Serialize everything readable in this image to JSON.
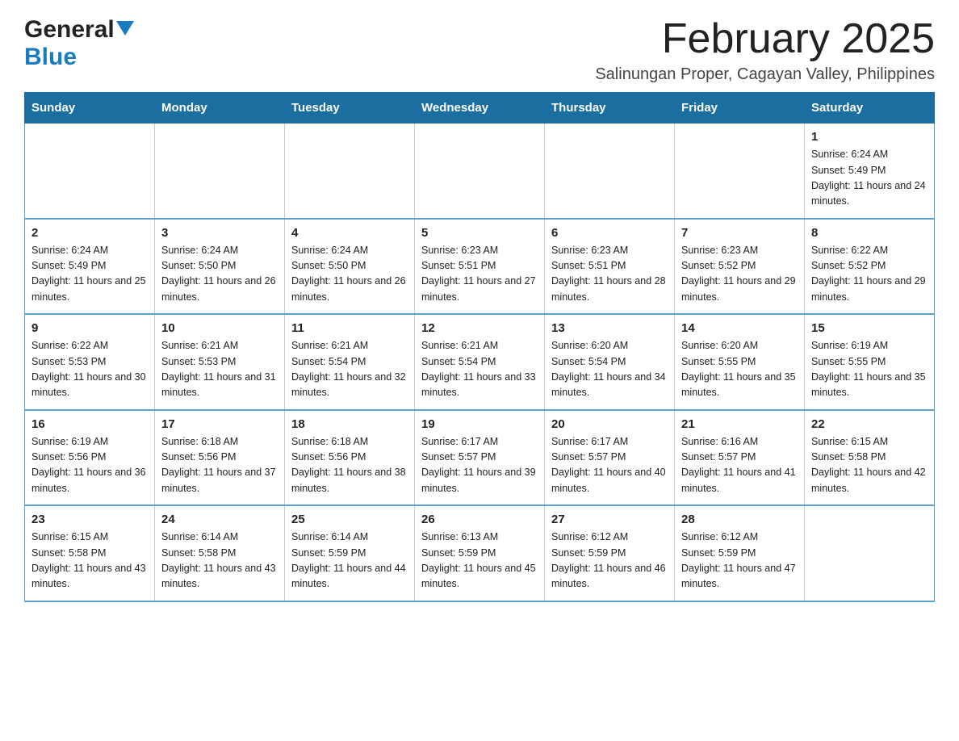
{
  "logo": {
    "general": "General",
    "blue": "Blue"
  },
  "title": {
    "month": "February 2025",
    "location": "Salinungan Proper, Cagayan Valley, Philippines"
  },
  "days_of_week": [
    "Sunday",
    "Monday",
    "Tuesday",
    "Wednesday",
    "Thursday",
    "Friday",
    "Saturday"
  ],
  "weeks": [
    [
      {
        "day": "",
        "info": ""
      },
      {
        "day": "",
        "info": ""
      },
      {
        "day": "",
        "info": ""
      },
      {
        "day": "",
        "info": ""
      },
      {
        "day": "",
        "info": ""
      },
      {
        "day": "",
        "info": ""
      },
      {
        "day": "1",
        "info": "Sunrise: 6:24 AM\nSunset: 5:49 PM\nDaylight: 11 hours and 24 minutes."
      }
    ],
    [
      {
        "day": "2",
        "info": "Sunrise: 6:24 AM\nSunset: 5:49 PM\nDaylight: 11 hours and 25 minutes."
      },
      {
        "day": "3",
        "info": "Sunrise: 6:24 AM\nSunset: 5:50 PM\nDaylight: 11 hours and 26 minutes."
      },
      {
        "day": "4",
        "info": "Sunrise: 6:24 AM\nSunset: 5:50 PM\nDaylight: 11 hours and 26 minutes."
      },
      {
        "day": "5",
        "info": "Sunrise: 6:23 AM\nSunset: 5:51 PM\nDaylight: 11 hours and 27 minutes."
      },
      {
        "day": "6",
        "info": "Sunrise: 6:23 AM\nSunset: 5:51 PM\nDaylight: 11 hours and 28 minutes."
      },
      {
        "day": "7",
        "info": "Sunrise: 6:23 AM\nSunset: 5:52 PM\nDaylight: 11 hours and 29 minutes."
      },
      {
        "day": "8",
        "info": "Sunrise: 6:22 AM\nSunset: 5:52 PM\nDaylight: 11 hours and 29 minutes."
      }
    ],
    [
      {
        "day": "9",
        "info": "Sunrise: 6:22 AM\nSunset: 5:53 PM\nDaylight: 11 hours and 30 minutes."
      },
      {
        "day": "10",
        "info": "Sunrise: 6:21 AM\nSunset: 5:53 PM\nDaylight: 11 hours and 31 minutes."
      },
      {
        "day": "11",
        "info": "Sunrise: 6:21 AM\nSunset: 5:54 PM\nDaylight: 11 hours and 32 minutes."
      },
      {
        "day": "12",
        "info": "Sunrise: 6:21 AM\nSunset: 5:54 PM\nDaylight: 11 hours and 33 minutes."
      },
      {
        "day": "13",
        "info": "Sunrise: 6:20 AM\nSunset: 5:54 PM\nDaylight: 11 hours and 34 minutes."
      },
      {
        "day": "14",
        "info": "Sunrise: 6:20 AM\nSunset: 5:55 PM\nDaylight: 11 hours and 35 minutes."
      },
      {
        "day": "15",
        "info": "Sunrise: 6:19 AM\nSunset: 5:55 PM\nDaylight: 11 hours and 35 minutes."
      }
    ],
    [
      {
        "day": "16",
        "info": "Sunrise: 6:19 AM\nSunset: 5:56 PM\nDaylight: 11 hours and 36 minutes."
      },
      {
        "day": "17",
        "info": "Sunrise: 6:18 AM\nSunset: 5:56 PM\nDaylight: 11 hours and 37 minutes."
      },
      {
        "day": "18",
        "info": "Sunrise: 6:18 AM\nSunset: 5:56 PM\nDaylight: 11 hours and 38 minutes."
      },
      {
        "day": "19",
        "info": "Sunrise: 6:17 AM\nSunset: 5:57 PM\nDaylight: 11 hours and 39 minutes."
      },
      {
        "day": "20",
        "info": "Sunrise: 6:17 AM\nSunset: 5:57 PM\nDaylight: 11 hours and 40 minutes."
      },
      {
        "day": "21",
        "info": "Sunrise: 6:16 AM\nSunset: 5:57 PM\nDaylight: 11 hours and 41 minutes."
      },
      {
        "day": "22",
        "info": "Sunrise: 6:15 AM\nSunset: 5:58 PM\nDaylight: 11 hours and 42 minutes."
      }
    ],
    [
      {
        "day": "23",
        "info": "Sunrise: 6:15 AM\nSunset: 5:58 PM\nDaylight: 11 hours and 43 minutes."
      },
      {
        "day": "24",
        "info": "Sunrise: 6:14 AM\nSunset: 5:58 PM\nDaylight: 11 hours and 43 minutes."
      },
      {
        "day": "25",
        "info": "Sunrise: 6:14 AM\nSunset: 5:59 PM\nDaylight: 11 hours and 44 minutes."
      },
      {
        "day": "26",
        "info": "Sunrise: 6:13 AM\nSunset: 5:59 PM\nDaylight: 11 hours and 45 minutes."
      },
      {
        "day": "27",
        "info": "Sunrise: 6:12 AM\nSunset: 5:59 PM\nDaylight: 11 hours and 46 minutes."
      },
      {
        "day": "28",
        "info": "Sunrise: 6:12 AM\nSunset: 5:59 PM\nDaylight: 11 hours and 47 minutes."
      },
      {
        "day": "",
        "info": ""
      }
    ]
  ]
}
